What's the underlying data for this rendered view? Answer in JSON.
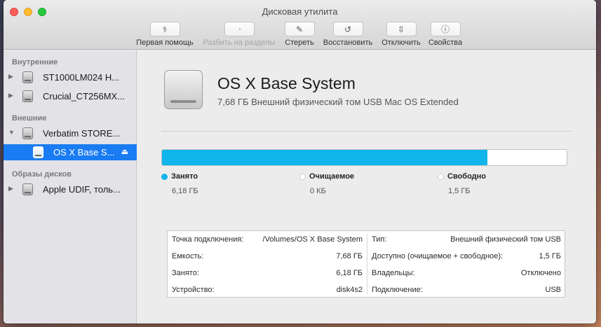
{
  "window": {
    "title": "Дисковая утилита"
  },
  "toolbar": {
    "first_aid": "Первая помощь",
    "partition": "Разбить на разделы",
    "erase": "Стереть",
    "restore": "Восстановить",
    "unmount": "Отключить",
    "info": "Свойства"
  },
  "sidebar": {
    "internal_header": "Внутренние",
    "external_header": "Внешние",
    "images_header": "Образы дисков",
    "items": [
      {
        "label": "ST1000LM024 H..."
      },
      {
        "label": "Crucial_CT256MX..."
      },
      {
        "label": "Verbatim STORE..."
      },
      {
        "label": "OS X Base S..."
      },
      {
        "label": "Apple UDIF, толь..."
      }
    ]
  },
  "volume": {
    "name": "OS X Base System",
    "description": "7,68 ГБ Внешний физический том USB Mac OS Extended"
  },
  "usage": {
    "used_fraction": 0.805,
    "used_color": "#10b5ec",
    "legend": [
      {
        "label": "Занято",
        "value": "6,18 ГБ"
      },
      {
        "label": "Очищаемое",
        "value": "0 КБ"
      },
      {
        "label": "Свободно",
        "value": "1,5 ГБ"
      }
    ]
  },
  "info": {
    "left": [
      {
        "key": "Точка подключения:",
        "value": "/Volumes/OS X Base System"
      },
      {
        "key": "Емкость:",
        "value": "7,68 ГБ"
      },
      {
        "key": "Занято:",
        "value": "6,18 ГБ"
      },
      {
        "key": "Устройство:",
        "value": "disk4s2"
      }
    ],
    "right": [
      {
        "key": "Тип:",
        "value": "Внешний физический том USB"
      },
      {
        "key": "Доступно (очищаемое + свободное):",
        "value": "1,5 ГБ"
      },
      {
        "key": "Владельцы:",
        "value": "Отключено"
      },
      {
        "key": "Подключение:",
        "value": "USB"
      }
    ]
  }
}
